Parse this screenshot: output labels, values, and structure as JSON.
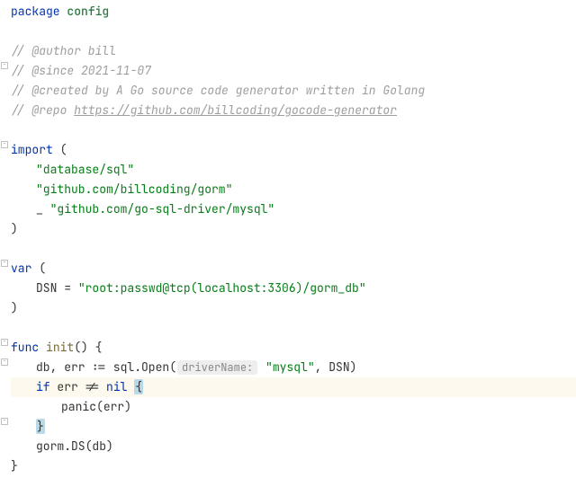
{
  "code": {
    "kw_package": "package",
    "pkg_name": "config",
    "comment_author": "// @author bill",
    "comment_since": "// @since 2021-11-07",
    "comment_created": "// @created by A Go source code generator written in Golang",
    "comment_repo_prefix": "// @repo ",
    "comment_repo_link": "https://github.com/billcoding/gocode-generator",
    "kw_import": "import",
    "paren_open": "(",
    "paren_close": ")",
    "import1": "\"database/sql\"",
    "import2": "\"github.com/billcoding/gorm\"",
    "blank_ident": "_",
    "import3": "\"github.com/go-sql-driver/mysql\"",
    "kw_var": "var",
    "var_name": "DSN",
    "eq": " = ",
    "dsn_value": "\"root:passwd@tcp(localhost:3306)/gorm_db\"",
    "kw_func": "func",
    "func_name": "init",
    "func_sig": "() {",
    "line_db_err": "db, err := sql.Open(",
    "param_hint": "driverName:",
    "mysql_str": " \"mysql\"",
    "after_mysql": ", DSN)",
    "kw_if": "if",
    "cond": " err != ",
    "kw_nil": "nil",
    "space": " ",
    "brace_open": "{",
    "panic_call": "panic",
    "panic_args": "(err)",
    "brace_close": "}",
    "gorm_call": "gorm.DS(db)",
    "final_brace": "}"
  },
  "fold_positions": [
    66,
    154,
    286,
    374,
    396,
    462
  ]
}
